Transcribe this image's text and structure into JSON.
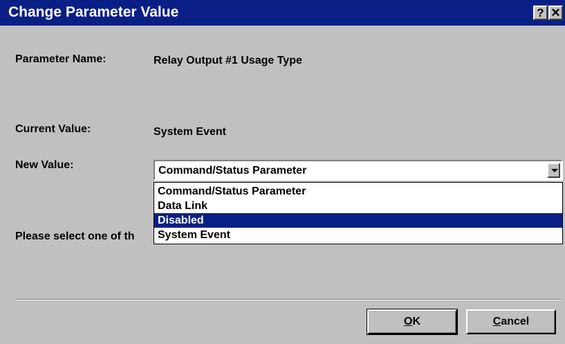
{
  "window": {
    "title": "Change Parameter Value",
    "help_glyph": "?",
    "close_glyph": "✕"
  },
  "fields": {
    "parameter_name_label": "Parameter Name:",
    "parameter_name_value": "Relay Output #1 Usage Type",
    "current_value_label": "Current Value:",
    "current_value_value": "System Event",
    "new_value_label": "New Value:",
    "new_value_selected": "Command/Status Parameter",
    "instruction": "Please select one of th"
  },
  "dropdown": {
    "options": [
      {
        "label": "Command/Status Parameter",
        "highlighted": false
      },
      {
        "label": "Data Link",
        "highlighted": false
      },
      {
        "label": "Disabled",
        "highlighted": true
      },
      {
        "label": "System Event",
        "highlighted": false
      }
    ]
  },
  "buttons": {
    "ok_mnemonic": "O",
    "ok_rest": "K",
    "cancel_mnemonic": "C",
    "cancel_rest": "ancel"
  },
  "colors": {
    "titlebar": "#0a1f86",
    "face": "#c0c0c0",
    "highlight": "#0a1f86"
  }
}
